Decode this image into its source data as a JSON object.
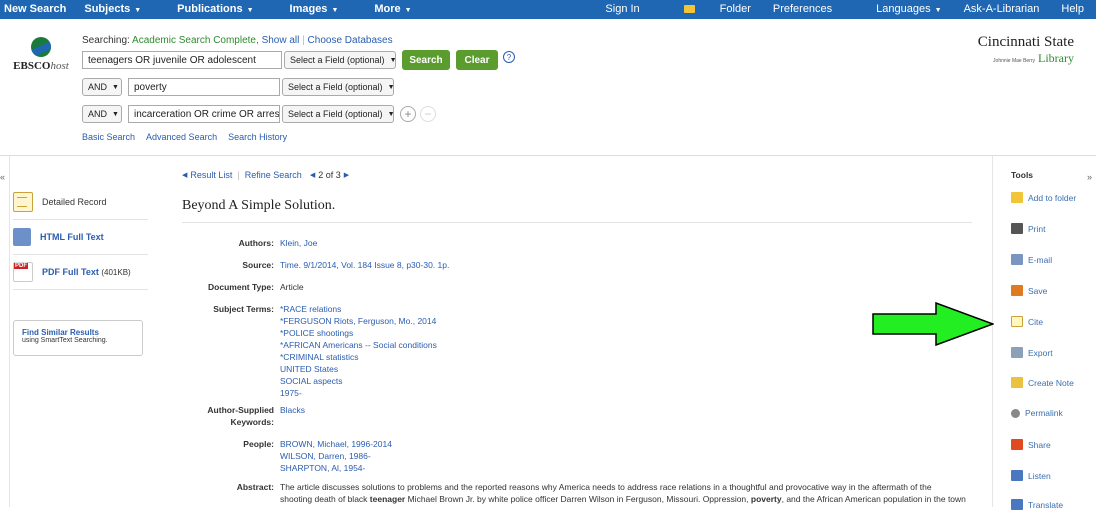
{
  "topnav": {
    "left": [
      "New Search",
      "Subjects",
      "Publications",
      "Images",
      "More"
    ],
    "right": [
      "Sign In",
      "Folder",
      "Preferences",
      "Languages",
      "Ask-A-Librarian",
      "Help"
    ]
  },
  "logo": {
    "brand_bold": "EBSCO",
    "brand_italic": "host"
  },
  "search": {
    "searching_label": "Searching:",
    "database": "Academic Search Complete,",
    "show_all": "Show all",
    "choose_databases": "Choose Databases",
    "rows": [
      {
        "bool": "",
        "term": "teenagers OR juvenile OR adolescent",
        "field": "Select a Field (optional)"
      },
      {
        "bool": "AND",
        "term": "poverty",
        "field": "Select a Field (optional)"
      },
      {
        "bool": "AND",
        "term": "incarceration OR crime OR arrest",
        "field": "Select a Field (optional)"
      }
    ],
    "search_button": "Search",
    "clear_button": "Clear",
    "help": "?",
    "plus": "+",
    "minus": "−",
    "links": [
      "Basic Search",
      "Advanced Search",
      "Search History"
    ]
  },
  "library": {
    "name": "Cincinnati State",
    "sub": "Johnnie Mae Berry",
    "lib": "Library"
  },
  "rails": {
    "left": "«",
    "right": "»"
  },
  "formats": [
    {
      "label": "Detailed Record",
      "extra": ""
    },
    {
      "label": "HTML Full Text",
      "extra": ""
    },
    {
      "label": "PDF Full Text",
      "extra": "(401KB)"
    }
  ],
  "similar": {
    "title": "Find Similar Results",
    "subtitle": "using SmartText Searching."
  },
  "result_nav": {
    "result_list": "Result List",
    "refine": "Refine Search",
    "position": "2 of 3"
  },
  "record": {
    "title": "Beyond A Simple Solution.",
    "authors_label": "Authors:",
    "authors": "Klein, Joe",
    "source_label": "Source:",
    "source_link": "Time.",
    "source_text": "9/1/2014, Vol. 184 Issue 8, p30-30. 1p.",
    "doctype_label": "Document Type:",
    "doctype": "Article",
    "subjects_label": "Subject Terms:",
    "subjects": [
      "*RACE relations",
      "*FERGUSON Riots, Ferguson, Mo., 2014",
      "*POLICE shootings",
      "*AFRICAN Americans -- Social conditions",
      "*CRIMINAL statistics",
      "UNITED States",
      "SOCIAL aspects",
      "1975-"
    ],
    "keywords_label_1": "Author-Supplied",
    "keywords_label_2": "Keywords:",
    "keywords": "Blacks",
    "people_label": "People:",
    "people": [
      "BROWN, Michael, 1996-2014",
      "WILSON, Darren, 1986-",
      "SHARPTON, Al, 1954-"
    ],
    "abstract_label": "Abstract:",
    "abstract_line1": "The article discusses solutions to problems and the reported reasons why America needs to address race relations in a thoughtful and provocative way in the aftermath of the",
    "abstract_line2_a": "shooting death of black ",
    "abstract_line2_b": "teenager",
    "abstract_line2_c": " Michael Brown Jr. by white police officer Darren Wilson in Ferguson, Missouri. Oppression, ",
    "abstract_line2_d": "poverty",
    "abstract_line2_e": ", and the African American population in the town"
  },
  "tools": {
    "header": "Tools",
    "items": [
      {
        "label": "Add to folder",
        "icon": "folder-icon"
      },
      {
        "label": "Print",
        "icon": "printer-icon"
      },
      {
        "label": "E-mail",
        "icon": "email-icon"
      },
      {
        "label": "Save",
        "icon": "save-icon"
      },
      {
        "label": "Cite",
        "icon": "cite-icon"
      },
      {
        "label": "Export",
        "icon": "export-icon"
      },
      {
        "label": "Create Note",
        "icon": "note-icon"
      },
      {
        "label": "Permalink",
        "icon": "link-icon"
      },
      {
        "label": "Share",
        "icon": "share-icon"
      },
      {
        "label": "Listen",
        "icon": "speaker-icon"
      },
      {
        "label": "Translate",
        "icon": "translate-icon"
      }
    ]
  },
  "colors": {
    "nav": "#1f67b3",
    "green_button": "#5a9c2e",
    "link": "#2a5db0",
    "arrow": "#22ee22"
  }
}
